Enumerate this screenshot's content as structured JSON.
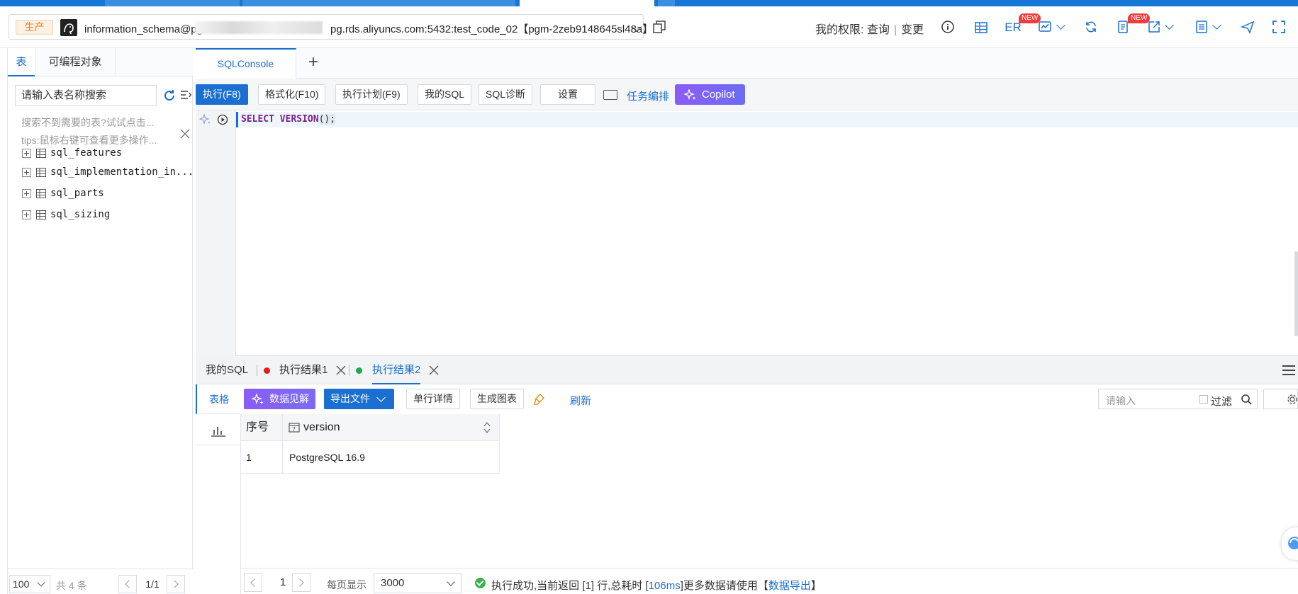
{
  "header": {
    "env_badge": "生产",
    "connection_prefix": "information_schema@pg",
    "connection_suffix": "pg.rds.aliyuncs.com:5432:test_code_02【pgm-2zeb9148645sl48a】",
    "permission_label": "我的权限:",
    "permission_query": "查询",
    "permission_change": "变更",
    "er_label": "ER",
    "new_badge": "NEW"
  },
  "left_panel": {
    "tabs": [
      "表",
      "可编程对象"
    ],
    "search_placeholder": "请输入表名称搜索",
    "hint_1": "搜索不到需要的表?试试点击...",
    "hint_2": "tips:鼠标右键可查看更多操作...",
    "tables": [
      "sql_features",
      "sql_implementation_in...",
      "sql_parts",
      "sql_sizing"
    ],
    "page_size": "100",
    "total": "共 4 条",
    "page": "1/1"
  },
  "editor": {
    "tab": "SQLConsole",
    "add_tab": "+",
    "toolbar": {
      "execute": "执行(F8)",
      "format": "格式化(F10)",
      "plan": "执行计划(F9)",
      "my_sql": "我的SQL",
      "diagnose": "SQL诊断",
      "settings": "设置",
      "task": "任务编排",
      "copilot": "Copilot"
    },
    "code_kw1": "SELECT",
    "code_kw2": "VERSION",
    "code_tail": "();"
  },
  "results": {
    "tabs": [
      "我的SQL",
      "执行结果1",
      "执行结果2"
    ],
    "side_tab": "表格",
    "toolbar": {
      "insight": "数据见解",
      "export": "导出文件",
      "row_detail": "单行详情",
      "gen_chart": "生成图表",
      "refresh": "刷新",
      "search_placeholder": "请输入",
      "filter": "过滤"
    },
    "columns": [
      "序号",
      "version"
    ],
    "rows": [
      [
        "1",
        "PostgreSQL 16.9"
      ]
    ],
    "footer": {
      "page": "1",
      "per_page_label": "每页显示",
      "per_page": "3000",
      "status_1": "执行成功,当前返回 [1] 行,总耗时 [",
      "status_ms": "106ms",
      "status_2": "]更多数据请使用【",
      "status_link": "数据导出",
      "status_3": "】"
    }
  },
  "colors": {
    "accent": "#1a6fd0",
    "copilot": "#8b5cf6",
    "success": "#3bb34a",
    "env": "#e8801a"
  }
}
